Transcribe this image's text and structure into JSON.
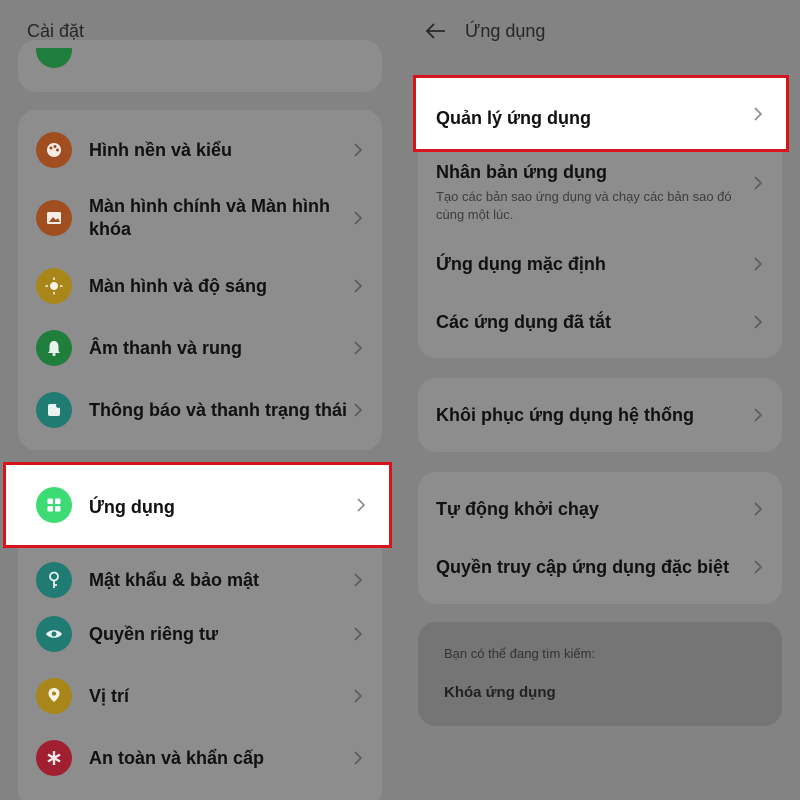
{
  "left": {
    "title": "Cài đặt",
    "items": [
      {
        "label": "Hình nền và kiểu",
        "color": "#a04e20"
      },
      {
        "label": "Màn hình chính và Màn hình khóa",
        "color": "#a04e20"
      },
      {
        "label": "Màn hình và độ sáng",
        "color": "#a8861a"
      },
      {
        "label": "Âm thanh và rung",
        "color": "#1f7e3c"
      },
      {
        "label": "Thông báo và thanh trạng thái",
        "color": "#207b73"
      },
      {
        "label": "Ứng dụng",
        "color": "#3ddb74"
      },
      {
        "label": "Mật khẩu & bảo mật",
        "color": "#207b73"
      },
      {
        "label": "Quyền riêng tư",
        "color": "#207b73"
      },
      {
        "label": "Vị trí",
        "color": "#a8861a"
      },
      {
        "label": "An toàn và khẩn cấp",
        "color": "#a01f31"
      }
    ]
  },
  "right": {
    "title": "Ứng dụng",
    "group1": [
      {
        "label": "Quản lý ứng dụng"
      },
      {
        "label": "Nhân bản ứng dụng",
        "desc": "Tạo các bản sao ứng dụng và chạy các bản sao đó cùng một lúc."
      },
      {
        "label": "Ứng dụng mặc định"
      },
      {
        "label": "Các ứng dụng đã tắt"
      }
    ],
    "group2": [
      {
        "label": "Khôi phục ứng dụng hệ thống"
      }
    ],
    "group3": [
      {
        "label": "Tự động khởi chạy"
      },
      {
        "label": "Quyền truy cập ứng dụng đặc biệt"
      }
    ],
    "hint": {
      "title": "Bạn có thể đang tìm kiếm:",
      "link": "Khóa ứng dụng"
    }
  },
  "colors": {
    "highlight_border": "#d9131c",
    "overlay": "#838383",
    "card": "#8d8d8d"
  }
}
